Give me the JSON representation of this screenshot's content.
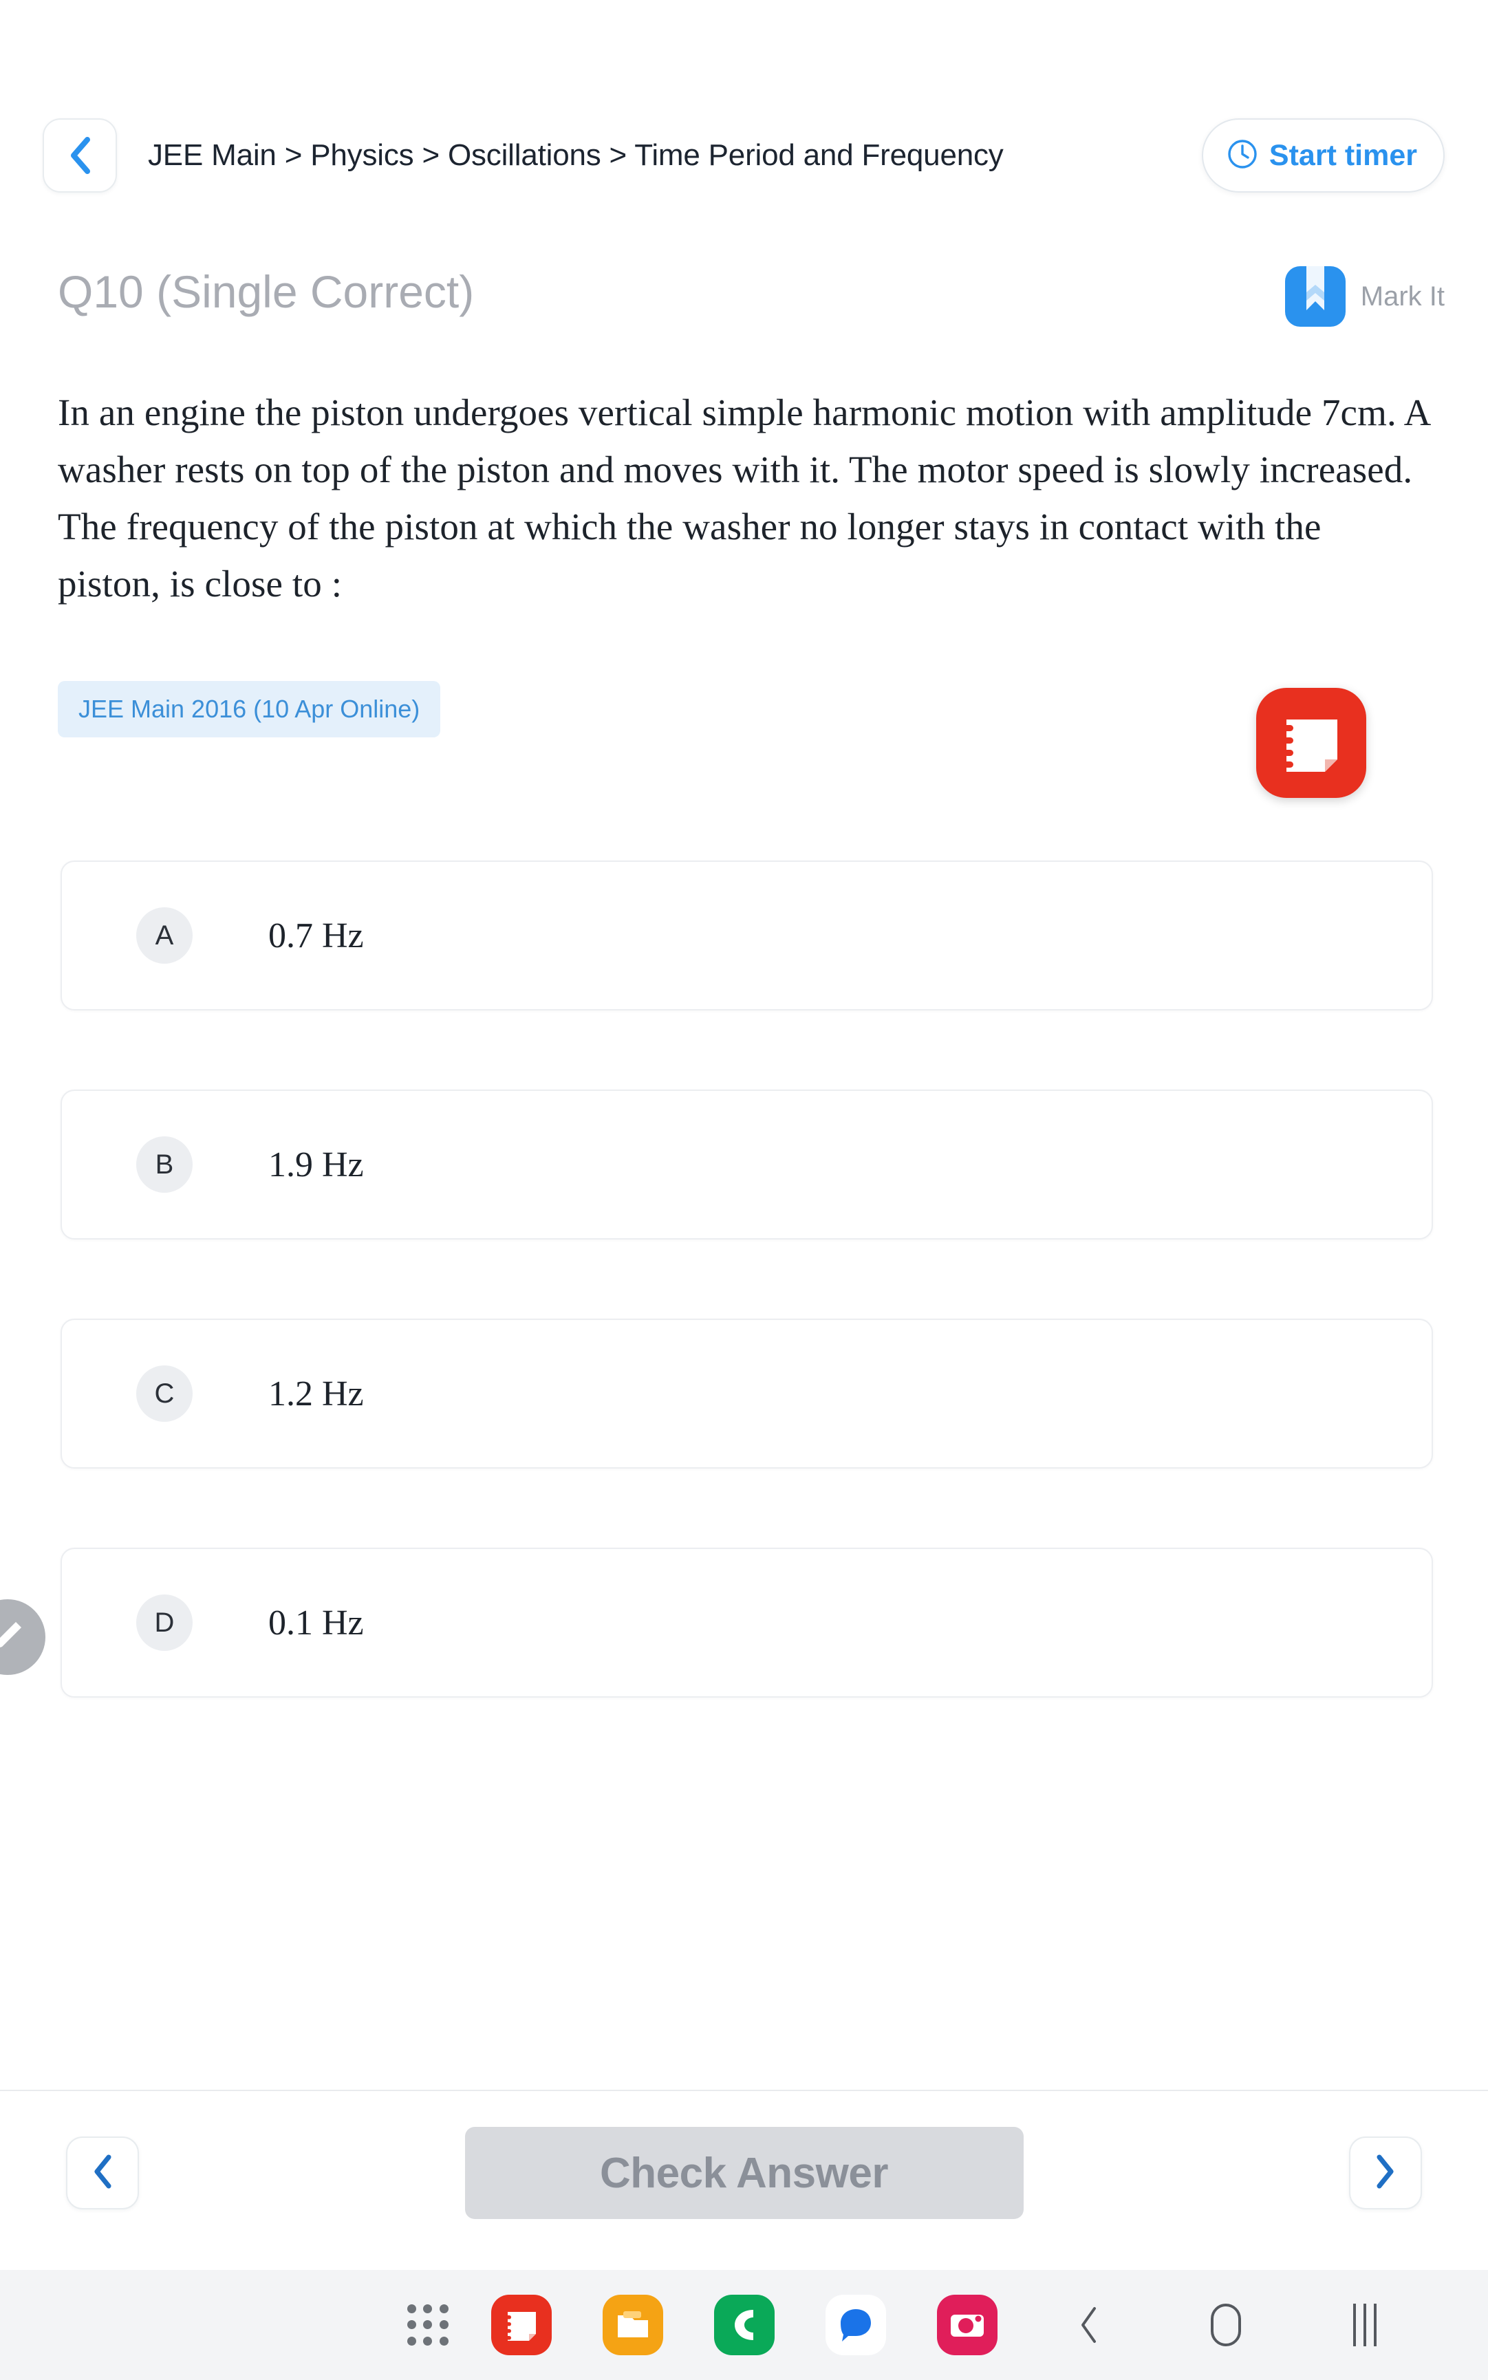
{
  "topbar": {
    "back_icon": "chevron-left-icon",
    "breadcrumb": "JEE Main > Physics > Oscillations > Time Period and Frequency",
    "timer_label": "Start timer",
    "timer_icon": "clock-icon",
    "accent_blue": "#2a92ee"
  },
  "question": {
    "title": "Q10 (Single Correct)",
    "mark_label": "Mark It",
    "mark_icon": "bookmark-icon",
    "text": "In an engine the piston undergoes vertical simple harmonic motion with amplitude 7cm. A washer rests on top of the piston and moves with it. The motor speed is slowly increased. The frequency of the piston at which the washer no longer stays in contact with the piston, is close to :",
    "exam_tag": "JEE Main 2016 (10 Apr Online)",
    "tag_color": "#3b8fd8",
    "tag_bg": "#e4f0fb"
  },
  "notes_overlay": {
    "icon": "samsung-notes-icon",
    "color": "#e8301f"
  },
  "options": [
    {
      "key": "A",
      "text": "0.7 Hz"
    },
    {
      "key": "B",
      "text": "1.9 Hz"
    },
    {
      "key": "C",
      "text": "1.2 Hz"
    },
    {
      "key": "D",
      "text": "0.1 Hz"
    }
  ],
  "fab": {
    "icon": "pencil-icon"
  },
  "actionbar": {
    "prev_icon": "chevron-left-icon",
    "next_icon": "chevron-right-icon",
    "check_label": "Check Answer",
    "check_disabled": true
  },
  "taskbar": {
    "apps_icon": "app-grid-icon",
    "items": [
      {
        "name": "notes-app-icon",
        "color": "#e8301f"
      },
      {
        "name": "my-files-app-icon",
        "color": "#f5a314"
      },
      {
        "name": "phone-app-icon",
        "color": "#0aa958"
      },
      {
        "name": "messages-app-icon",
        "color": "#1a73e8"
      },
      {
        "name": "camera-app-icon",
        "color": "#e01e5a"
      }
    ],
    "system": [
      {
        "name": "nav-back-icon"
      },
      {
        "name": "nav-home-icon"
      },
      {
        "name": "nav-recents-icon"
      }
    ]
  }
}
